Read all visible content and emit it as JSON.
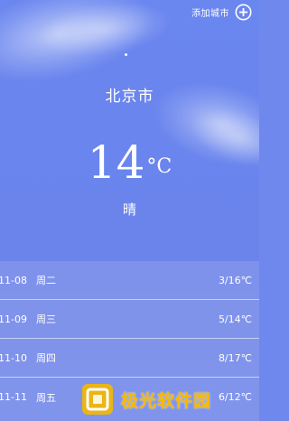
{
  "header": {
    "add_city_label": "添加城市",
    "add_icon": "plus-circle-icon"
  },
  "current": {
    "city": "北京市",
    "temperature": "14",
    "unit": "°C",
    "condition": "晴"
  },
  "forecast": [
    {
      "date": "11-08",
      "weekday": "周二",
      "range": "3/16℃"
    },
    {
      "date": "11-09",
      "weekday": "周三",
      "range": "5/14℃"
    },
    {
      "date": "11-10",
      "weekday": "周四",
      "range": "8/17℃"
    },
    {
      "date": "11-11",
      "weekday": "周五",
      "range": "6/12℃"
    }
  ],
  "watermark": {
    "text": "极光软件园",
    "logo": "watermark-logo-icon"
  },
  "colors": {
    "background": "#6a86ef",
    "forecast_panel": "#8294ea",
    "text": "#ffffff",
    "watermark": "#f5b800"
  }
}
